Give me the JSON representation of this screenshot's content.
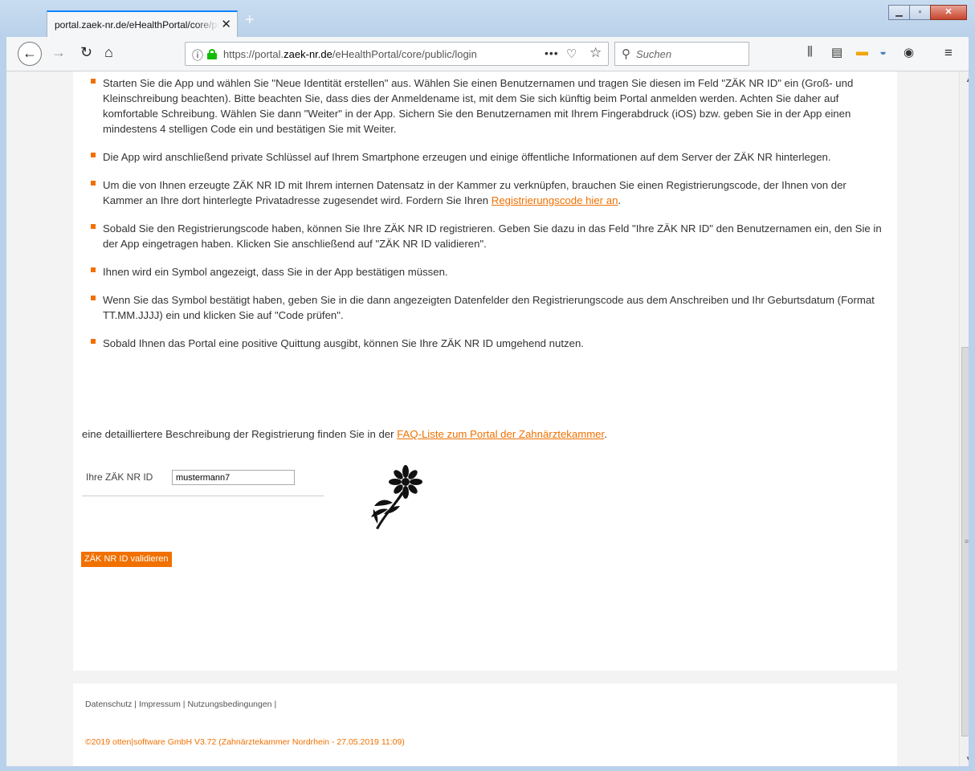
{
  "browser": {
    "tab_title": "portal.zaek-nr.de/eHealthPortal/core/public/login",
    "tab_close": "✕",
    "new_tab": "+",
    "url_prefix": "https://portal.",
    "url_domain": "zaek-nr.de",
    "url_path": "/eHealthPortal/core/public/login",
    "search_placeholder": "Suchen"
  },
  "steps": [
    "Starten Sie die App und wählen Sie \"Neue Identität erstellen\" aus. Wählen Sie einen Benutzernamen und tragen Sie diesen im Feld \"ZÄK NR ID\" ein (Groß- und Kleinschreibung beachten). Bitte beachten Sie, dass dies der Anmeldename ist, mit dem Sie sich künftig beim Portal anmelden werden. Achten Sie daher auf komfortable Schreibung. Wählen Sie dann \"Weiter\" in der App. Sichern Sie den Benutzernamen mit Ihrem Fingerabdruck (iOS) bzw. geben Sie in der App einen mindestens 4 stelligen Code ein und bestätigen Sie mit Weiter.",
    "Die App wird anschließend private Schlüssel auf Ihrem Smartphone erzeugen und einige öffentliche Informationen auf dem Server der ZÄK NR hinterlegen.",
    "Um die von Ihnen erzeugte ZÄK NR ID mit Ihrem internen Datensatz in der Kammer zu verknüpfen, brauchen Sie einen Registrierungscode, der Ihnen von der Kammer an Ihre dort hinterlegte Privatadresse zugesendet wird. Fordern Sie Ihren ",
    "Sobald Sie den Registrierungscode haben, können Sie Ihre ZÄK NR ID registrieren. Geben Sie dazu in das Feld \"Ihre ZÄK NR ID\" den Benutzernamen ein, den Sie in der App eingetragen haben. Klicken Sie anschließend auf \"ZÄK NR ID validieren\".",
    "Ihnen wird ein Symbol angezeigt, dass Sie in der App bestätigen müssen.",
    "Wenn Sie das Symbol bestätigt haben, geben Sie in die dann angezeigten Datenfelder den Registrierungscode aus dem Anschreiben und Ihr Geburtsdatum (Format TT.MM.JJJJ) ein und klicken Sie auf \"Code prüfen\".",
    "Sobald Ihnen das Portal eine positive Quittung ausgibt, können Sie Ihre ZÄK NR ID umgehend nutzen."
  ],
  "step3_link": "Registrierungscode hier an",
  "step3_after": ".",
  "description_text": "eine detailliertere Beschreibung der Registrierung finden Sie in der ",
  "description_link": "FAQ-Liste zum Portal der Zahnärztekammer",
  "description_after": ".",
  "form": {
    "id_label": "Ihre ZÄK NR ID",
    "id_value": "mustermann7",
    "validate_label": "ZÄK NR ID validieren",
    "symbol_icon": "flower-icon"
  },
  "footer": {
    "links": [
      "Datenschutz",
      "Impressum",
      "Nutzungsbedingungen"
    ],
    "separator": " | ",
    "trailing": " |",
    "copyright": "©2019 otten|software GmbH V3.72 (Zahnärztekammer Nordrhein - 27.05.2019 11:09)"
  },
  "colors": {
    "accent": "#f07000",
    "tab_highlight": "#0a84ff",
    "lock_green": "#12bc00"
  }
}
